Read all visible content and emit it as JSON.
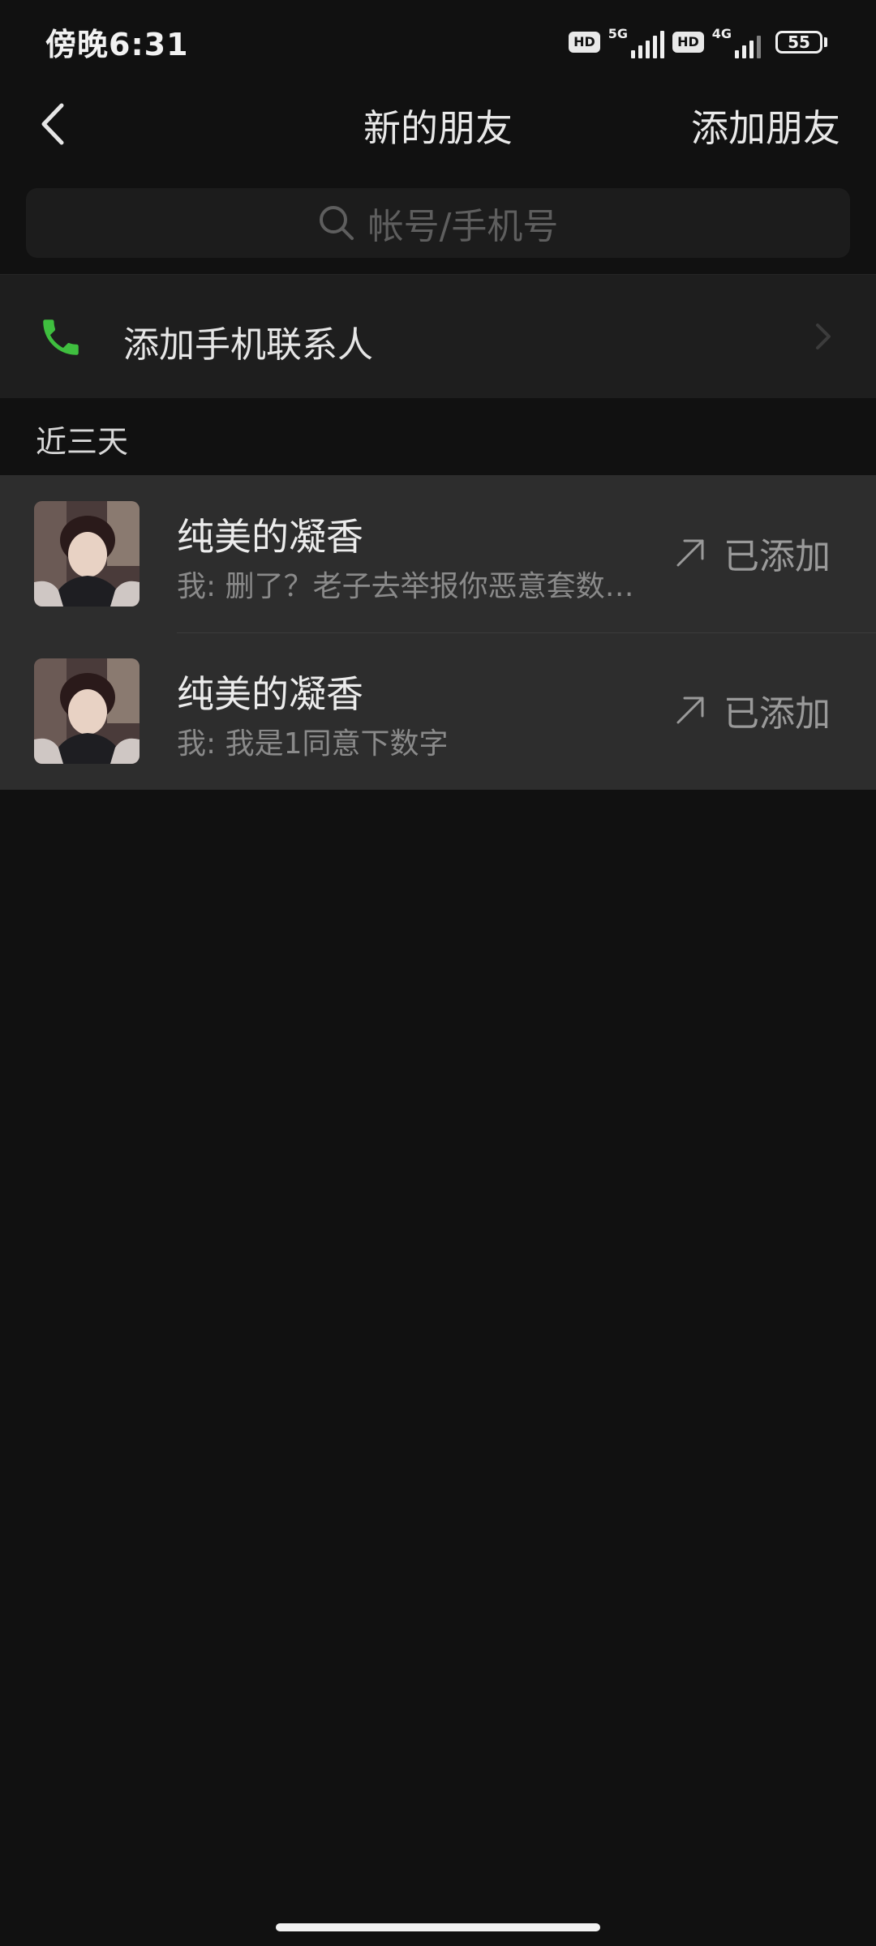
{
  "status_bar": {
    "time": "傍晚6:31",
    "hd1": "HD",
    "network1": "5G",
    "hd2": "HD",
    "network2": "4G",
    "battery": "55"
  },
  "nav": {
    "title": "新的朋友",
    "action": "添加朋友"
  },
  "search": {
    "placeholder": "帐号/手机号"
  },
  "add_contacts": {
    "label": "添加手机联系人",
    "icon": "phone-icon",
    "icon_color": "#3fbf3f"
  },
  "section": {
    "title": "近三天"
  },
  "friends": [
    {
      "name": "纯美的凝香",
      "message": "我: 删了？老子去举报你恶意套数…",
      "status": "已添加"
    },
    {
      "name": "纯美的凝香",
      "message": "我: 我是1同意下数字",
      "status": "已添加"
    }
  ]
}
